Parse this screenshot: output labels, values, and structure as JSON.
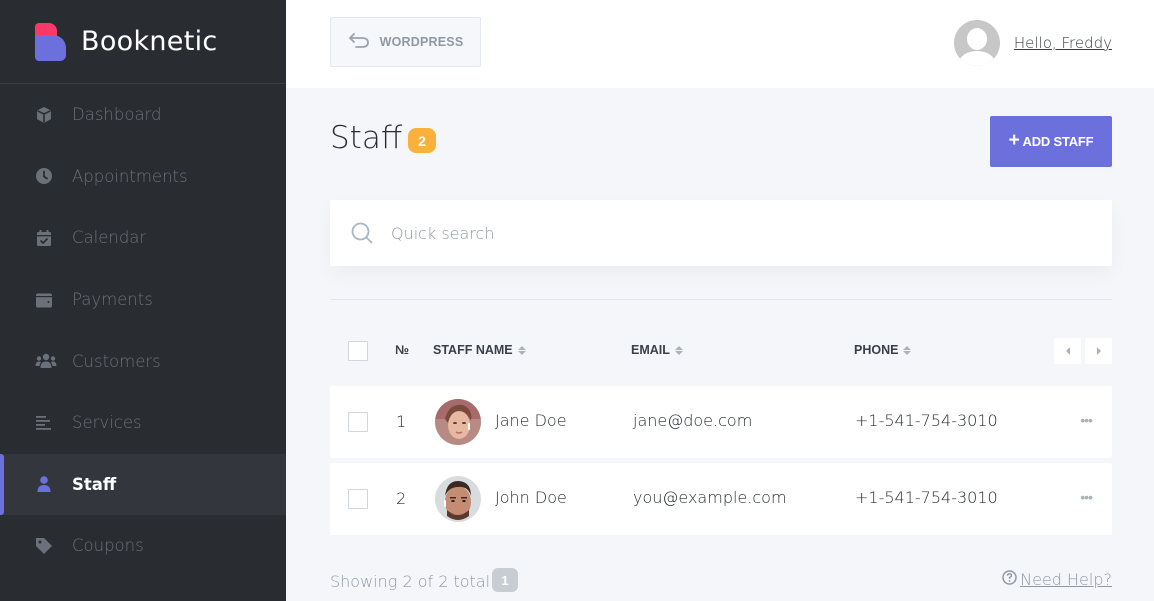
{
  "brand": {
    "name": "Booknetic"
  },
  "sidebar": {
    "items": [
      {
        "label": "Dashboard",
        "icon": "cube-icon",
        "active": false
      },
      {
        "label": "Appointments",
        "icon": "clock-icon",
        "active": false
      },
      {
        "label": "Calendar",
        "icon": "calendar-check-icon",
        "active": false
      },
      {
        "label": "Payments",
        "icon": "wallet-icon",
        "active": false
      },
      {
        "label": "Customers",
        "icon": "users-icon",
        "active": false
      },
      {
        "label": "Services",
        "icon": "list-icon",
        "active": false
      },
      {
        "label": "Staff",
        "icon": "user-icon",
        "active": true
      },
      {
        "label": "Coupons",
        "icon": "tag-icon",
        "active": false
      }
    ]
  },
  "topbar": {
    "back_label": "WORDPRESS",
    "greeting": "Hello, Freddy"
  },
  "page": {
    "title": "Staff",
    "count": "2",
    "add_button_label": "ADD STAFF",
    "add_button_icon": "+"
  },
  "search": {
    "placeholder": "Quick search",
    "value": ""
  },
  "table": {
    "columns": [
      "№",
      "STAFF NAME",
      "EMAIL",
      "PHONE"
    ],
    "rows": [
      {
        "num": "1",
        "name": "Jane Doe",
        "email": "jane@doe.com",
        "phone": "+1-541-754-3010",
        "actions": "•••"
      },
      {
        "num": "2",
        "name": "John Doe",
        "email": "you@example.com",
        "phone": "+1-541-754-3010",
        "actions": "•••"
      }
    ]
  },
  "footer": {
    "showing": "Showing 2 of 2 total",
    "page": "1",
    "help_label": "Need Help?"
  },
  "colors": {
    "accent": "#6c70dc",
    "brand_red": "#fc3868",
    "badge_orange": "#fbb03b",
    "sidebar_bg": "#292d32"
  }
}
